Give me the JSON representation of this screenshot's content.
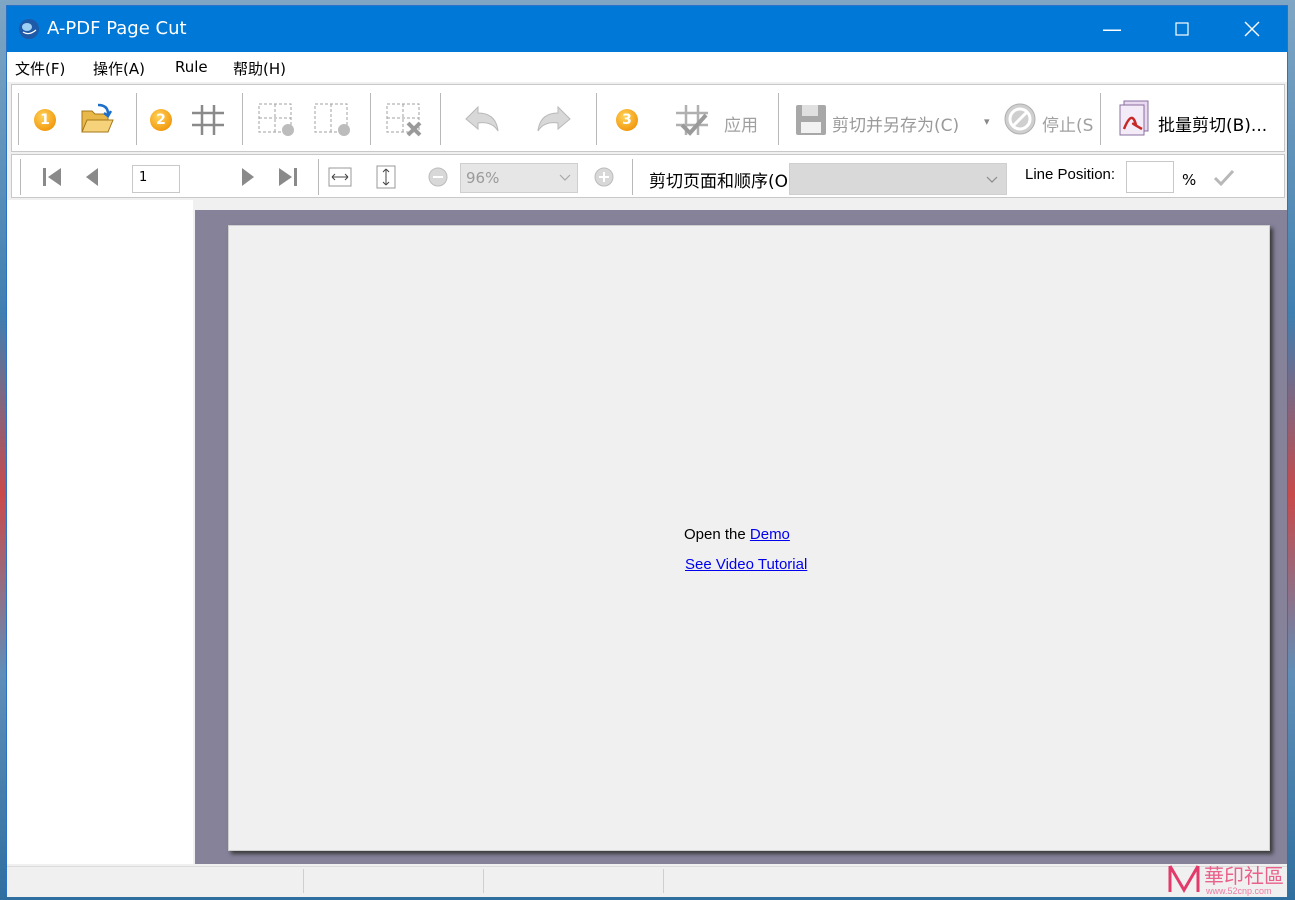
{
  "window": {
    "title": "A-PDF Page Cut"
  },
  "menu": {
    "items": [
      "文件(F)",
      "操作(A)",
      "Rule",
      "帮助(H)"
    ]
  },
  "toolbar": {
    "step1": "1",
    "step2": "2",
    "step3": "3",
    "apply_label": "应用",
    "save_as_label": "剪切并另存为(C)",
    "stop_label": "停止(S",
    "batch_label": "批量剪切(B)..."
  },
  "nav": {
    "page_value": "1",
    "zoom_value": "96%",
    "cut_order_label": "剪切页面和顺序(O",
    "line_position_label": "Line Position:",
    "percent": "%"
  },
  "content": {
    "open_prefix": "Open the",
    "demo_link": "Demo",
    "tutorial_link": "See Video Tutorial"
  },
  "watermark": {
    "main": "華印社區",
    "sub": "www.52cnp.com"
  },
  "colors": {
    "titlebar": "#0078d7",
    "badge": "#f39c12",
    "link": "#0000ee",
    "viewer_bg": "#85829a"
  }
}
